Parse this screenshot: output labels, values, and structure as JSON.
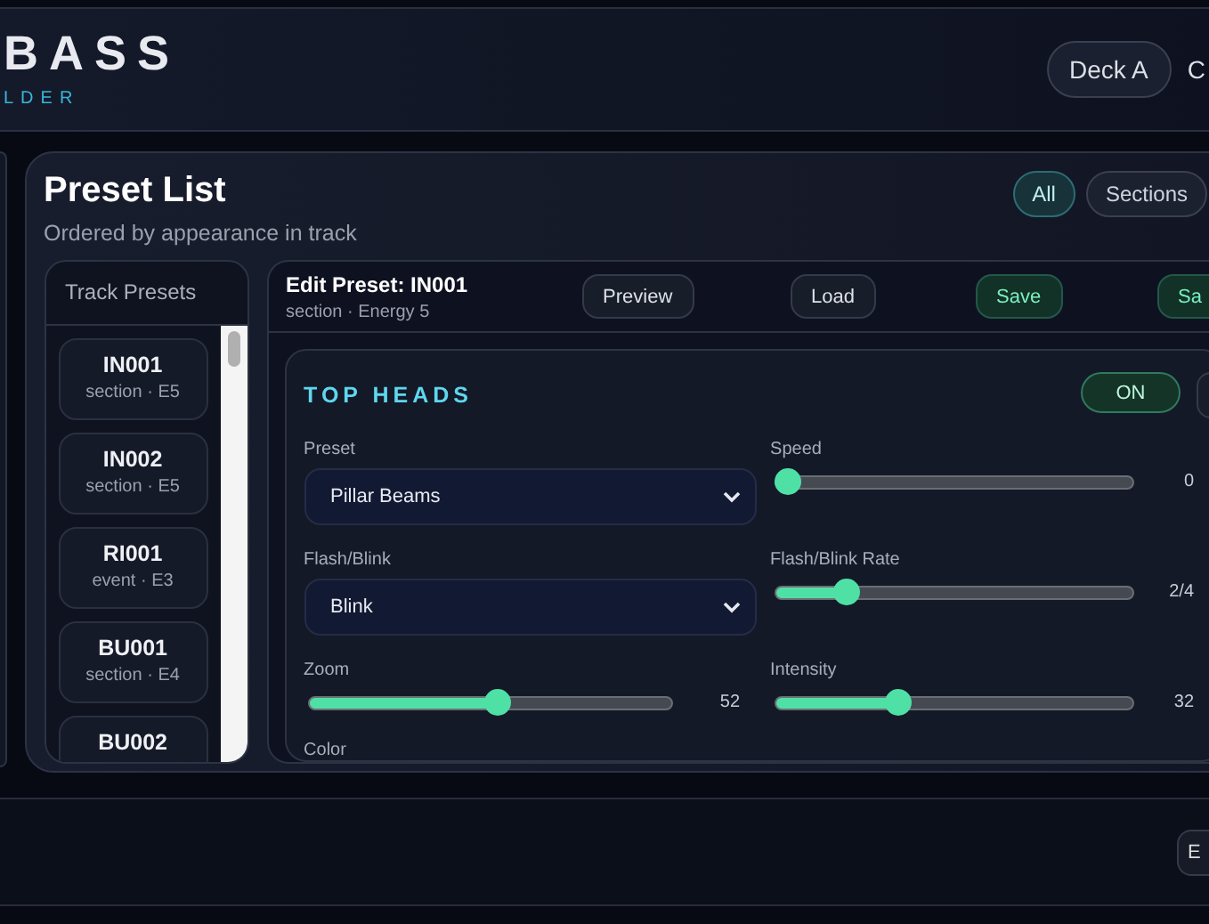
{
  "header": {
    "logo": "BASS",
    "tagline": "LDER",
    "deck_buttons": [
      {
        "label": "Deck A"
      },
      {
        "label": "C"
      }
    ]
  },
  "preset_list": {
    "title": "Preset List",
    "subtitle": "Ordered by appearance in track",
    "filters": [
      {
        "label": "All",
        "selected": true
      },
      {
        "label": "Sections",
        "selected": false
      }
    ]
  },
  "track_presets": {
    "title": "Track Presets",
    "items": [
      {
        "code": "IN001",
        "meta": "section · E5"
      },
      {
        "code": "IN002",
        "meta": "section · E5"
      },
      {
        "code": "RI001",
        "meta": "event · E3"
      },
      {
        "code": "BU001",
        "meta": "section · E4"
      },
      {
        "code": "BU002"
      }
    ]
  },
  "editor": {
    "title": "Edit Preset: IN001",
    "subtitle": "section · Energy 5",
    "actions": [
      {
        "label": "Preview",
        "kind": "plain"
      },
      {
        "label": "Load",
        "kind": "plain"
      },
      {
        "label": "Save",
        "kind": "accent"
      },
      {
        "label": "Sa",
        "kind": "accent"
      }
    ]
  },
  "section": {
    "title": "TOP HEADS",
    "toggle_label": "ON",
    "on": true,
    "controls": [
      {
        "kind": "select",
        "label": "Preset",
        "value": "Pillar Beams"
      },
      {
        "kind": "slider",
        "label": "Speed",
        "level": 0,
        "reading": "0"
      },
      {
        "kind": "select",
        "label": "Flash/Blink",
        "value": "Blink"
      },
      {
        "kind": "slider",
        "label": "Flash/Blink Rate",
        "level": 0.18,
        "reading": "2/4"
      },
      {
        "kind": "slider",
        "label": "Zoom",
        "level": 0.52,
        "reading": "52"
      },
      {
        "kind": "slider",
        "label": "Intensity",
        "level": 0.33,
        "reading": "32"
      },
      {
        "kind": "label",
        "label": "Color"
      }
    ]
  },
  "footer": {
    "button": "E"
  }
}
